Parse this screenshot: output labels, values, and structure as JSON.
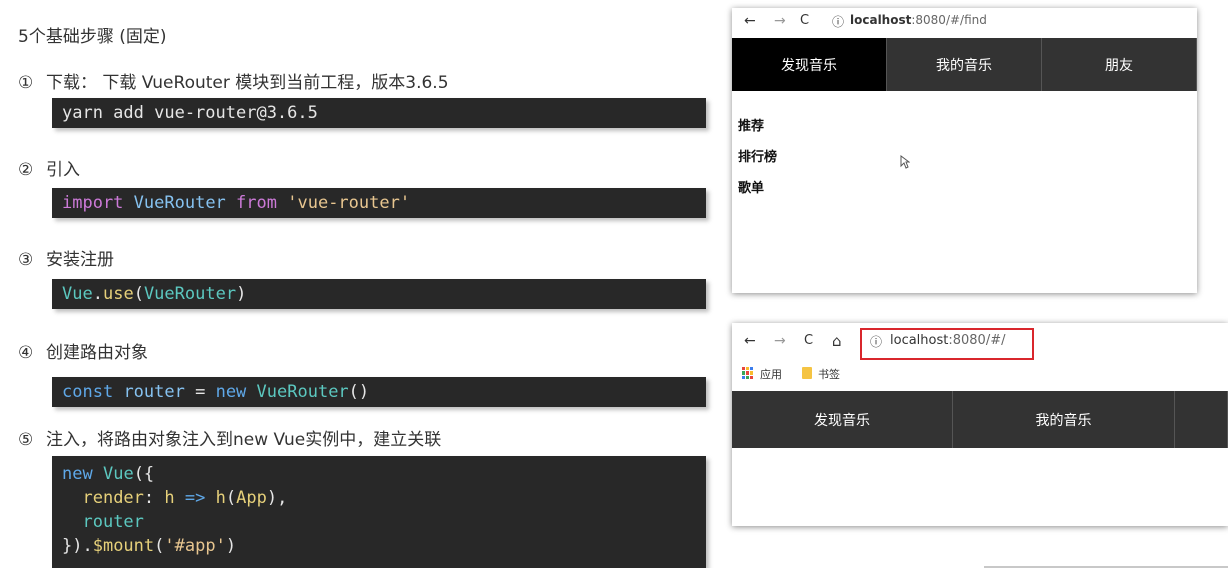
{
  "heading": "5个基础步骤 (固定)",
  "steps": [
    {
      "num": "①",
      "text": "下载： 下载 VueRouter 模块到当前工程，版本3.6.5"
    },
    {
      "num": "②",
      "text": "引入"
    },
    {
      "num": "③",
      "text": "安装注册"
    },
    {
      "num": "④",
      "text": "创建路由对象"
    },
    {
      "num": "⑤",
      "text": "注入，将路由对象注入到new Vue实例中，建立关联"
    }
  ],
  "code": {
    "install": "yarn add vue-router@3.6.5",
    "import": {
      "kw1": "import",
      "name": "VueRouter",
      "kw2": "from",
      "str": "'vue-router'"
    },
    "use": {
      "obj": "Vue",
      "dot": ".",
      "method": "use",
      "open": "(",
      "arg": "VueRouter",
      "close": ")"
    },
    "create": {
      "kw": "const",
      "var": "router",
      "eq": " = ",
      "new": "new",
      "cls": "VueRouter",
      "parens": "()"
    },
    "inject": {
      "l1_new": "new",
      "l1_cls": "Vue",
      "l1_rest": "({",
      "l2_key": "render",
      "l2_colon": ": ",
      "l2_h": "h",
      "l2_arrow": "=>",
      "l2_fn": "h",
      "l2_open": "(",
      "l2_arg": "App",
      "l2_close": "),",
      "l3": "router",
      "l4_a": "}).",
      "l4_fn": "$mount",
      "l4_open": "(",
      "l4_str": "'#app'",
      "l4_close": ")"
    }
  },
  "browser1": {
    "back": "←",
    "forward": "→",
    "reload": "C",
    "info": "ⓘ",
    "url_host": "localhost",
    "url_rest": ":8080/#/find",
    "tabs": [
      "发现音乐",
      "我的音乐",
      "朋友"
    ],
    "menu": [
      "推荐",
      "排行榜",
      "歌单"
    ]
  },
  "browser2": {
    "back": "←",
    "forward": "→",
    "reload": "C",
    "home": "⌂",
    "info": "ⓘ",
    "url_host": "localhost",
    "url_rest": ":8080/#/",
    "bookmarks": [
      "应用",
      "书签"
    ],
    "tabs": [
      "发现音乐",
      "我的音乐"
    ]
  }
}
